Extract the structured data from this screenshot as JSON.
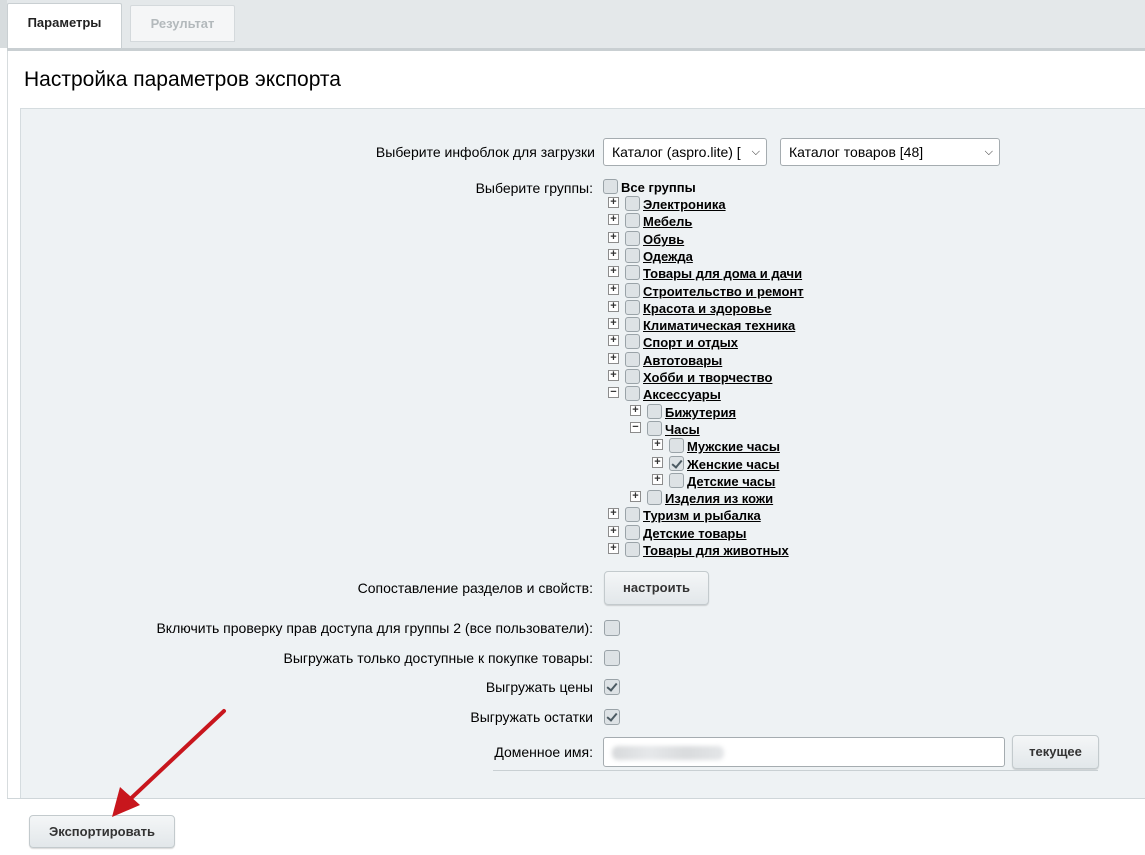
{
  "tabs": [
    {
      "label": "Параметры",
      "active": true
    },
    {
      "label": "Результат",
      "active": false
    }
  ],
  "page_title": "Настройка параметров экспорта",
  "iblock": {
    "label": "Выберите инфоблок для загрузки",
    "type_select": "Каталог (aspro.lite) [",
    "catalog_select": "Каталог товаров [48]"
  },
  "groups": {
    "label": "Выберите группы:",
    "all_label": "Все группы",
    "items": [
      {
        "label": "Электроника",
        "expand": "+",
        "checked": false
      },
      {
        "label": "Мебель",
        "expand": "+",
        "checked": false
      },
      {
        "label": "Обувь",
        "expand": "+",
        "checked": false
      },
      {
        "label": "Одежда",
        "expand": "+",
        "checked": false
      },
      {
        "label": "Товары для дома и дачи",
        "expand": "+",
        "checked": false
      },
      {
        "label": "Строительство и ремонт",
        "expand": "+",
        "checked": false
      },
      {
        "label": "Красота и здоровье",
        "expand": "+",
        "checked": false
      },
      {
        "label": "Климатическая техника",
        "expand": "+",
        "checked": false
      },
      {
        "label": "Спорт и отдых",
        "expand": "+",
        "checked": false
      },
      {
        "label": "Автотовары",
        "expand": "+",
        "checked": false
      },
      {
        "label": "Хобби и творчество",
        "expand": "+",
        "checked": false
      },
      {
        "label": "Аксессуары",
        "expand": "−",
        "checked": false
      },
      {
        "label": "Бижутерия",
        "expand": "+",
        "checked": false
      },
      {
        "label": "Часы",
        "expand": "−",
        "checked": false
      },
      {
        "label": "Мужские часы",
        "expand": "+",
        "checked": false
      },
      {
        "label": "Женские часы",
        "expand": "+",
        "checked": true
      },
      {
        "label": "Детские часы",
        "expand": "+",
        "checked": false
      },
      {
        "label": "Изделия из кожи",
        "expand": "+",
        "checked": false
      },
      {
        "label": "Туризм и рыбалка",
        "expand": "+",
        "checked": false
      },
      {
        "label": "Детские товары",
        "expand": "+",
        "checked": false
      },
      {
        "label": "Товары для животных",
        "expand": "+",
        "checked": false
      }
    ]
  },
  "mapping": {
    "label": "Сопоставление разделов и свойств:",
    "button": "настроить"
  },
  "options": [
    {
      "label": "Включить проверку прав доступа для группы 2 (все пользователи):",
      "checked": false
    },
    {
      "label": "Выгружать только доступные к покупке товары:",
      "checked": false
    },
    {
      "label": "Выгружать цены",
      "checked": true
    },
    {
      "label": "Выгружать остатки",
      "checked": true
    }
  ],
  "domain": {
    "label": "Доменное имя:",
    "button": "текущее"
  },
  "export_button": "Экспортировать",
  "colors": {
    "form_bg": "#eef2f4",
    "arrow": "#c8161d"
  }
}
